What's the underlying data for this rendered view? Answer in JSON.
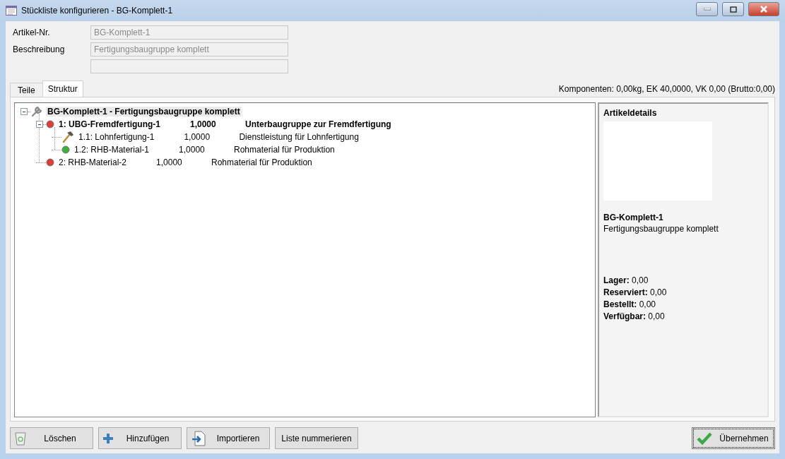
{
  "window": {
    "title": "Stückliste konfigurieren - BG-Komplett-1"
  },
  "fields": [
    {
      "label": "Artikel-Nr.",
      "value": "BG-Komplett-1",
      "disabled": true
    },
    {
      "label": "Beschreibung",
      "value": "Fertigungsbaugruppe komplett",
      "disabled": true
    },
    {
      "disabled": true
    }
  ],
  "tabs": [
    {
      "label": "Teile",
      "selected": false
    },
    {
      "label": "Struktur",
      "selected": true
    }
  ],
  "summary": "Komponenten: 0,00kg, EK 40,0000, VK 0,00 (Brutto:0,00)",
  "tree": [
    {
      "kind": "wrench",
      "label": "BG-Komplett-1 - Fertigungsbaugruppe komplett",
      "bold": true,
      "selected": true,
      "expanded": true,
      "children": [
        {
          "kind": "dot",
          "color": "#d9403a",
          "label": "1: UBG-Fremdfertigung-1",
          "quantity": "1,0000",
          "description": "Unterbaugruppe zur Fremdfertigung",
          "bold": true,
          "selected": false,
          "expanded": true,
          "children": [
            {
              "kind": "hammer",
              "label": "1.1: Lohnfertigung-1",
              "quantity": "1,0000",
              "description": "Dienstleistung für Lohnfertigung",
              "bold": false,
              "selected": false
            },
            {
              "kind": "dot",
              "color": "#3fae3a",
              "label": "1.2: RHB-Material-1",
              "quantity": "1,0000",
              "description": "Rohmaterial für Produktion",
              "bold": false,
              "selected": false
            }
          ]
        },
        {
          "kind": "dot",
          "color": "#d9403a",
          "label": "2: RHB-Material-2",
          "quantity": "1,0000",
          "description": "Rohmaterial für Produktion",
          "bold": false,
          "selected": false
        }
      ]
    }
  ],
  "details": {
    "title": "Artikeldetails",
    "name": "BG-Komplett-1",
    "description": "Fertigungsbaugruppe komplett",
    "stock": [
      {
        "label": "Lager:",
        "value": "0,00"
      },
      {
        "label": "Reserviert:",
        "value": "0,00"
      },
      {
        "label": "Bestellt:",
        "value": "0,00"
      },
      {
        "label": "Verfügbar:",
        "value": "0,00"
      }
    ]
  },
  "buttons": [
    {
      "kind": "trash",
      "label": "Löschen",
      "focused": false
    },
    {
      "kind": "plus",
      "label": "Hinzufügen",
      "focused": false
    },
    {
      "kind": "import",
      "label": "Importieren",
      "focused": false
    },
    {
      "kind": "plain",
      "label": "Liste nummerieren",
      "focused": false
    }
  ],
  "confirm": {
    "kind": "check",
    "label": "Übernehmen",
    "focused": true
  }
}
